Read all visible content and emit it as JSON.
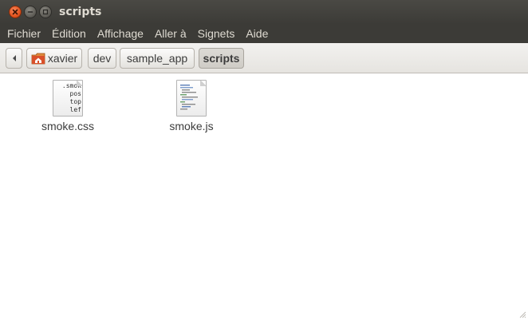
{
  "window": {
    "title": "scripts"
  },
  "menubar": {
    "items": [
      "Fichier",
      "Édition",
      "Affichage",
      "Aller à",
      "Signets",
      "Aide"
    ]
  },
  "pathbar": {
    "crumbs": [
      {
        "label": "xavier",
        "icon": "home-folder-icon"
      },
      {
        "label": "dev"
      },
      {
        "label": "sample_app"
      },
      {
        "label": "scripts",
        "active": true
      }
    ]
  },
  "files": [
    {
      "name": "smoke.css",
      "icon": "css-file-icon",
      "preview_lines": [
        ".smok",
        "pos",
        "top",
        "lef"
      ]
    },
    {
      "name": "smoke.js",
      "icon": "javascript-file-icon"
    }
  ],
  "colors": {
    "titlebar": "#3c3b37",
    "close_button": "#e4551f",
    "content_bg": "#ffffff"
  }
}
